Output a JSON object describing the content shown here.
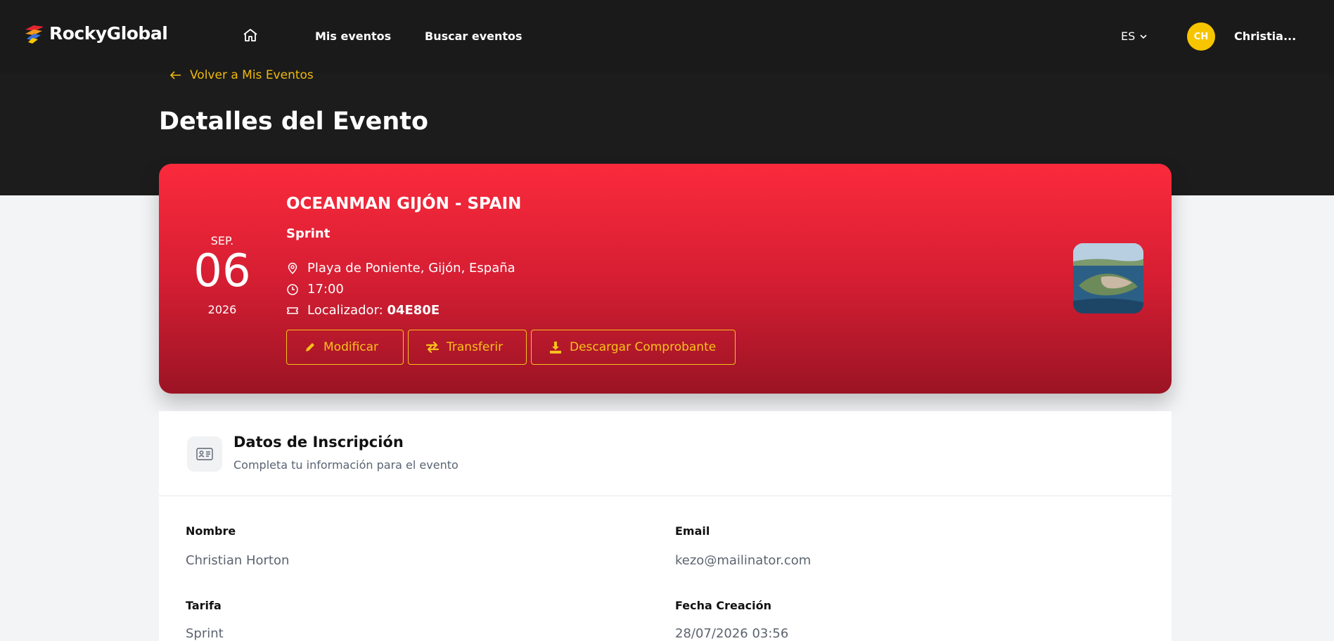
{
  "brand": {
    "name": "RockyGlobal"
  },
  "nav": {
    "home_icon": "home-icon",
    "links": [
      "Mis eventos",
      "Buscar eventos"
    ],
    "language": "ES",
    "avatar_initials": "CH",
    "username": "Christia..."
  },
  "header": {
    "back_label": "Volver a Mis Eventos",
    "page_title": "Detalles del Evento"
  },
  "event": {
    "month": "SEP.",
    "day": "06",
    "year": "2026",
    "title": "OCEANMAN GIJÓN - SPAIN",
    "category": "Sprint",
    "location": "Playa de Poniente, Gijón, España",
    "time": "17:00",
    "locator_label": "Localizador:",
    "locator_code": "04E80E",
    "buttons": {
      "modify": "Modificar",
      "transfer": "Transferir",
      "download": "Descargar Comprobante"
    }
  },
  "registration": {
    "title": "Datos de Inscripción",
    "subtitle": "Completa tu información para el evento",
    "fields": [
      {
        "label": "Nombre",
        "value": "Christian Horton"
      },
      {
        "label": "Email",
        "value": "kezo@mailinator.com"
      },
      {
        "label": "Tarifa",
        "value": "Sprint"
      },
      {
        "label": "Fecha Creación",
        "value": "28/07/2026 03:56"
      }
    ]
  },
  "colors": {
    "nav_bg": "#1a1a1a",
    "accent_yellow": "#f7c21b",
    "card_red_top": "#fb2a3c",
    "card_red_bottom": "#9b1424"
  }
}
